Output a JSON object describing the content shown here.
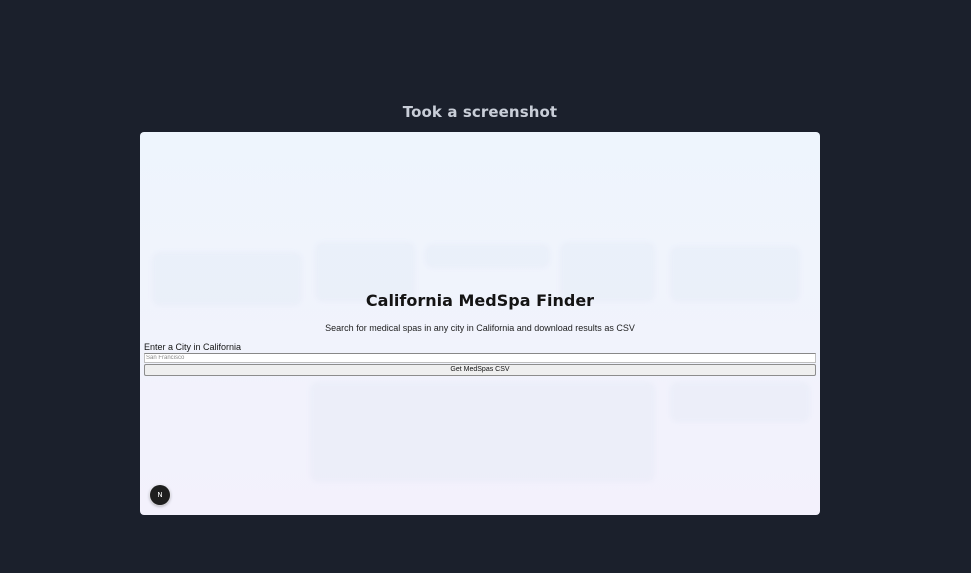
{
  "caption": "Took a screenshot",
  "page": {
    "title": "California MedSpa Finder",
    "subtitle": "Search for medical spas in any city in California and download results as CSV",
    "form": {
      "city_label": "Enter a City in California",
      "city_placeholder": "San Francisco",
      "city_value": "",
      "submit_label": "Get MedSpas CSV"
    },
    "dev_badge": "N"
  }
}
